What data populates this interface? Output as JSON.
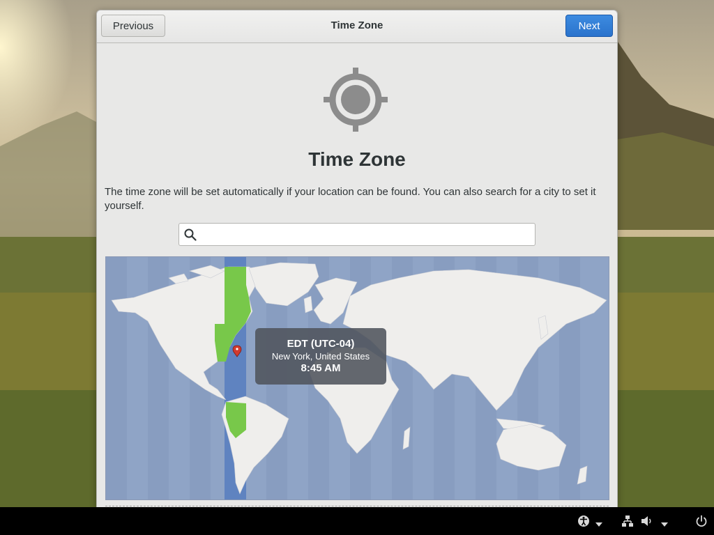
{
  "window": {
    "header_title": "Time Zone",
    "previous_label": "Previous",
    "next_label": "Next"
  },
  "page": {
    "icon": "location-target-icon",
    "title": "Time Zone",
    "description": "The time zone will be set automatically if your location can be found. You can also search for a city to set it yourself."
  },
  "search": {
    "icon": "search-icon",
    "value": "",
    "placeholder": ""
  },
  "map": {
    "selected_zone_highlight_color": "#78c84a",
    "tooltip": {
      "zone": "EDT (UTC-04)",
      "city": "New York, United States",
      "time": "8:45 AM"
    },
    "marker_icon": "location-pin-icon"
  },
  "taskbar": {
    "icons": [
      "accessibility-icon",
      "chevron-down-icon",
      "network-icon",
      "volume-icon",
      "chevron-down-icon",
      "power-icon"
    ]
  },
  "colors": {
    "accent": "#2a73cc",
    "taskbar": "#000000",
    "window_bg": "#e8e8e7",
    "ocean": "#8fa4c6",
    "land": "#efeeec"
  }
}
